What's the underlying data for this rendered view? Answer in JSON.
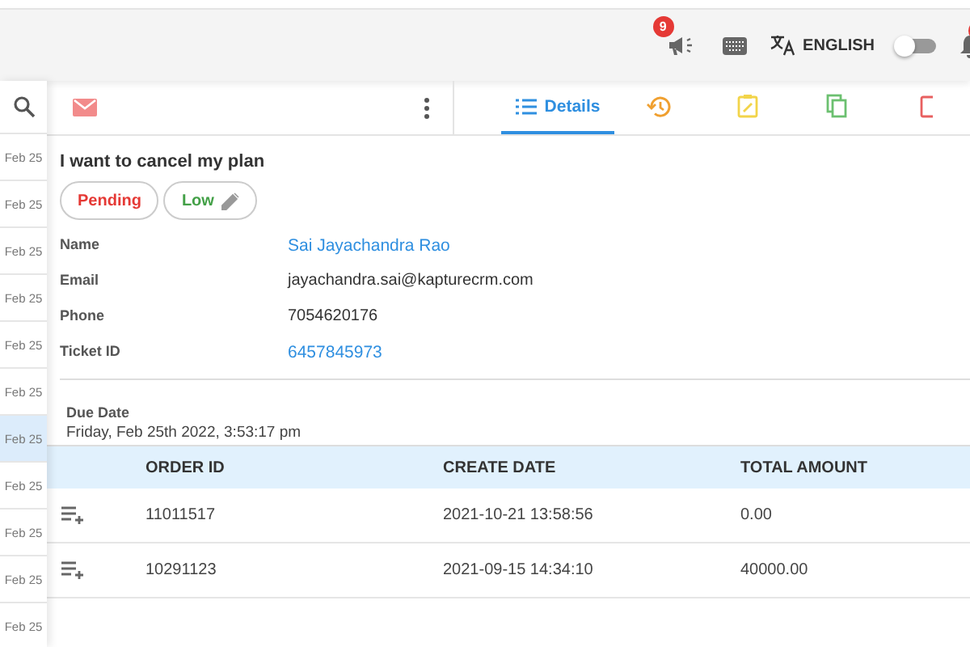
{
  "topbar": {
    "announcement_badge": "9",
    "language": "ENGLISH",
    "toggle": {
      "on": false
    },
    "bell_badge_cut": true
  },
  "sidebar": {
    "items": [
      {
        "date": "Feb 25",
        "selected": false
      },
      {
        "date": "Feb 25",
        "selected": false
      },
      {
        "date": "Feb 25",
        "selected": false
      },
      {
        "date": "Feb 25",
        "selected": false
      },
      {
        "date": "Feb 25",
        "selected": false
      },
      {
        "date": "Feb 25",
        "selected": false
      },
      {
        "date": "Feb 25",
        "selected": true
      },
      {
        "date": "Feb 25",
        "selected": false
      },
      {
        "date": "Feb 25",
        "selected": false
      },
      {
        "date": "Feb 25",
        "selected": false
      },
      {
        "date": "Feb 25",
        "selected": false
      }
    ]
  },
  "tabs": [
    {
      "kind": "details",
      "label": "Details",
      "selected": true
    },
    {
      "kind": "history",
      "selected": false
    },
    {
      "kind": "notes",
      "selected": false
    },
    {
      "kind": "copy",
      "selected": false
    },
    {
      "kind": "delete",
      "selected": false
    }
  ],
  "ticket": {
    "title": "I want to cancel my plan",
    "status": "Pending",
    "priority": "Low",
    "fields": [
      {
        "label": "Name",
        "value": "Sai Jayachandra Rao",
        "kind": "link"
      },
      {
        "label": "Email",
        "value": "jayachandra.sai@kapturecrm.com",
        "kind": "text"
      },
      {
        "label": "Phone",
        "value": "7054620176",
        "kind": "text"
      },
      {
        "label": "Ticket ID",
        "value": "6457845973",
        "kind": "link"
      }
    ],
    "due_date_label": "Due Date",
    "due_date": "Friday, Feb 25th 2022, 3:53:17 pm"
  },
  "orders": {
    "columns": [
      "ORDER ID",
      "CREATE DATE",
      "TOTAL AMOUNT"
    ],
    "rows": [
      [
        "11011517",
        "2021-10-21 13:58:56",
        "0.00"
      ],
      [
        "10291123",
        "2021-09-15 14:34:10",
        "40000.00"
      ]
    ]
  }
}
